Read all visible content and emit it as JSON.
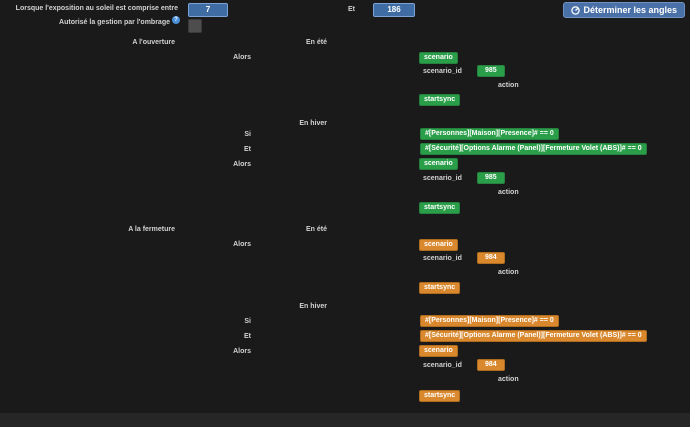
{
  "colors": {
    "accent_green": "#2b9e4a",
    "accent_green_border": "#25813e",
    "accent_orange": "#d9882e",
    "accent_orange_border": "#b06c1f",
    "input_blue": "#3e6ca3",
    "button_blue": "#4a70a8"
  },
  "settings": {
    "exposure_label": "Lorsque l'exposition au soleil est comprise entre",
    "exposure_min": "7",
    "and_label": "Et",
    "exposure_max": "186",
    "determine_angles_button": "Déterminer les angles",
    "shading_label": "Autorisé la gestion par l'ombrage",
    "help_icon": "?"
  },
  "opening": {
    "title": "A l'ouverture",
    "summer": {
      "title": "En été",
      "then_label": "Alors",
      "scenario_tag": "scenario",
      "scenario_id_label": "scenario_id",
      "scenario_id": "985",
      "action_label": "action",
      "startsync_tag": "startsync"
    },
    "winter": {
      "title": "En hiver",
      "if_label": "Si",
      "if_condition": "#[Personnes][Maison][Presence]# == 0",
      "and_label": "Et",
      "and_condition": "#[Sécurité][Options Alarme (Panel)][Fermeture Volet (ABS)]# == 0",
      "then_label": "Alors",
      "scenario_tag": "scenario",
      "scenario_id_label": "scenario_id",
      "scenario_id": "985",
      "action_label": "action",
      "startsync_tag": "startsync"
    }
  },
  "closing": {
    "title": "A la fermeture",
    "summer": {
      "title": "En été",
      "then_label": "Alors",
      "scenario_tag": "scenario",
      "scenario_id_label": "scenario_id",
      "scenario_id": "984",
      "action_label": "action",
      "startsync_tag": "startsync"
    },
    "winter": {
      "title": "En hiver",
      "if_label": "Si",
      "if_condition": "#[Personnes][Maison][Presence]# == 0",
      "and_label": "Et",
      "and_condition": "#[Sécurité][Options Alarme (Panel)][Fermeture Volet (ABS)]# == 0",
      "then_label": "Alors",
      "scenario_tag": "scenario",
      "scenario_id_label": "scenario_id",
      "scenario_id": "984",
      "action_label": "action",
      "startsync_tag": "startsync"
    }
  }
}
